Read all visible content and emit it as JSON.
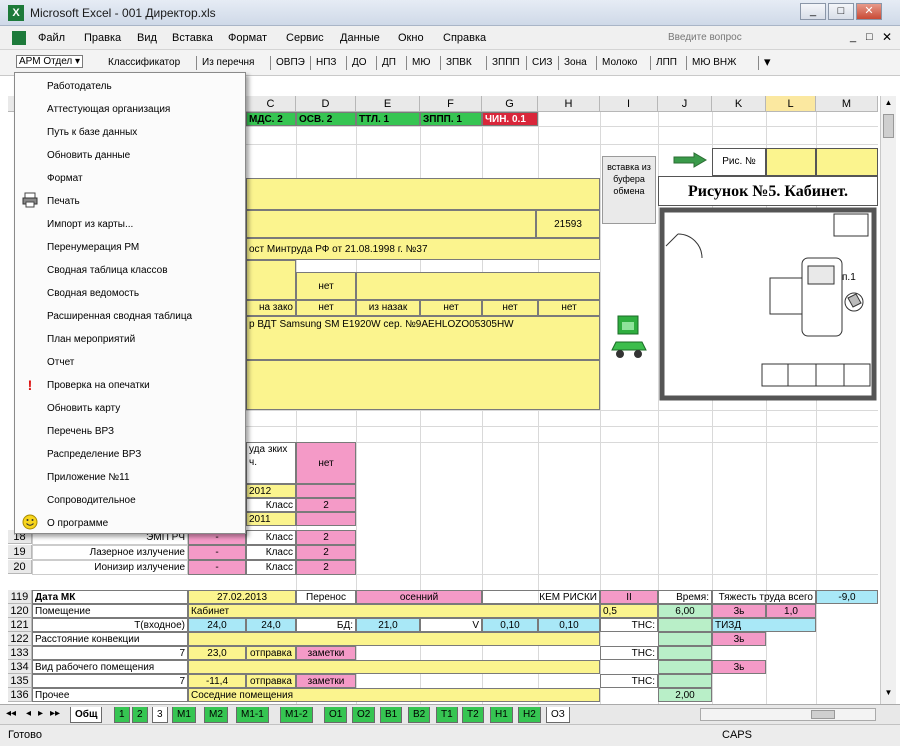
{
  "window": {
    "title": "Microsoft Excel - 001 Директор.xls",
    "icon": "excel-icon",
    "controls": [
      "_",
      "□",
      "✕"
    ]
  },
  "menu": {
    "items": [
      "Файл",
      "Правка",
      "Вид",
      "Вставка",
      "Формат",
      "Сервис",
      "Данные",
      "Окно",
      "Справка"
    ],
    "question": "Введите вопрос"
  },
  "toolbar": {
    "items": [
      "АРМ Отдел ▾",
      "Классификатор",
      "Из перечня",
      "ОВПЭ",
      "НПЗ",
      "ДО",
      "ДП",
      "МЮ",
      "ЗПВК",
      "ЗППП",
      "СИЗ",
      "Зона",
      "Молоко",
      "ЛПП",
      "МЮ ВНЖ"
    ]
  },
  "dropdown": {
    "items": [
      {
        "label": "Работодатель",
        "icon": ""
      },
      {
        "label": "Аттестующая организация",
        "icon": ""
      },
      {
        "label": "Путь к базе данных",
        "icon": ""
      },
      {
        "label": "Обновить данные",
        "icon": ""
      },
      {
        "label": "Формат",
        "icon": ""
      },
      {
        "label": "Печать",
        "icon": "printer-icon"
      },
      {
        "label": "Импорт из карты...",
        "icon": ""
      },
      {
        "label": "Перенумерация РМ",
        "icon": ""
      },
      {
        "label": "Сводная таблица классов",
        "icon": ""
      },
      {
        "label": "Сводная ведомость",
        "icon": ""
      },
      {
        "label": "Расширенная сводная таблица",
        "icon": ""
      },
      {
        "label": "План мероприятий",
        "icon": ""
      },
      {
        "label": "Отчет",
        "icon": ""
      },
      {
        "label": "Проверка на опечатки",
        "icon": "exclamation-icon"
      },
      {
        "label": "Обновить карту",
        "icon": ""
      },
      {
        "label": "Перечень ВРЗ",
        "icon": ""
      },
      {
        "label": "Распределение ВРЗ",
        "icon": ""
      },
      {
        "label": "Приложение №11",
        "icon": ""
      },
      {
        "label": "Сопроводительное",
        "icon": ""
      },
      {
        "label": "О программе",
        "icon": "smiley-icon"
      }
    ]
  },
  "columns": [
    "C",
    "D",
    "E",
    "F",
    "G",
    "H",
    "I",
    "J",
    "K",
    "L",
    "M"
  ],
  "rows": {
    "upper": [
      "18",
      "19",
      "20"
    ],
    "lower": [
      "119",
      "120",
      "121",
      "122",
      "133",
      "134",
      "135",
      "136"
    ]
  },
  "cells": {
    "hdr_c": "МДС. 2",
    "hdr_d": "ОСВ. 2",
    "hdr_e": "ТТЛ. 1",
    "hdr_f": "ЗППП. 1",
    "hdr_g": "ЧИН. 0.1",
    "num_h": "21593",
    "order": "ост Минтруда РФ от 21.08.1998 г. №37",
    "net1": "нет",
    "nazak": "на зако",
    "net2": "нет",
    "iznazak": "из назак",
    "net3": "нет",
    "net4": "нет",
    "net5": "нет",
    "device": "р ВДТ Samsung SM E1920W сер. №9AEHLOZO05305HW",
    "klass_hdr": "уда зких ч.",
    "net_pink": "нет",
    "y2012": "2012",
    "klass1": "Класс",
    "v2a": "2",
    "y2011": "2011",
    "r18_label": "ЭМП РЧ",
    "r18_b": "-",
    "r18_k": "Класс",
    "r18_v": "2",
    "r19_label": "Лазерное излучение",
    "r19_b": "-",
    "r19_k": "Класс",
    "r19_v": "2",
    "r20_label": "Ионизир излучение",
    "r20_b": "-",
    "r20_k": "Класс",
    "r20_v": "2",
    "r119_label": "Дата МК",
    "r119_date": "27.02.2013",
    "r119_per": "Перенос",
    "r119_sost": "осенний",
    "r119_rk": "КЕМ РИСКИ",
    "r119_ii": "II",
    "r119_vr": "Время:",
    "r119_tt": "Тяжесть труда всего",
    "r119_val": "-9,0",
    "r120_label": "Помещение",
    "r120_val": "Кабинет",
    "r120_05": "0,5",
    "r120_600": "6,00",
    "r120_3": "3ь",
    "r120_10": "1,0",
    "r121_label": "T(входное)",
    "r121_a": "24,0",
    "r121_b": "24,0",
    "r121_bd": "БД:",
    "r121_c": "21,0",
    "r121_v": "V",
    "r121_d": "0,10",
    "r121_e": "0,10",
    "r121_tns": "ТНС:",
    "r121_tizd": "ТИЗД",
    "r122_label": "Расстояние конвекции",
    "r122_3b": "3ь",
    "r133_label": "7",
    "r133_a": "23,0",
    "r133_b": "отправка",
    "r133_c": "заметки",
    "r133_tns": "ТНС:",
    "r134_label": "Вид рабочего помещения",
    "r134_3b": "3ь",
    "r135_label": "7",
    "r135_a": "-11,4",
    "r135_b": "отправка",
    "r135_c": "заметки",
    "r135_tns": "ТНС:",
    "r136_label": "Прочее",
    "r136_val": "Соседние помещения",
    "r136_200": "2,00"
  },
  "picture": {
    "ref_label": "Рис. №",
    "insert_button": "вставка из буфера обмена",
    "title": "Рисунок №5. Кабинет.",
    "mark": "п.1"
  },
  "sheets": [
    "Общ",
    "1",
    "2",
    "3",
    "М1",
    "М2",
    "М1-1",
    "М1-2",
    "О1",
    "О2",
    "В1",
    "В2",
    "Т1",
    "Т2",
    "Н1",
    "Н2",
    "ОЗ"
  ],
  "status": {
    "left": "Готово",
    "caps": "CAPS"
  },
  "colors": {
    "yellow": "#fbf48e",
    "green": "#36c552",
    "red": "#d9263a",
    "pink": "#f49ac7"
  }
}
